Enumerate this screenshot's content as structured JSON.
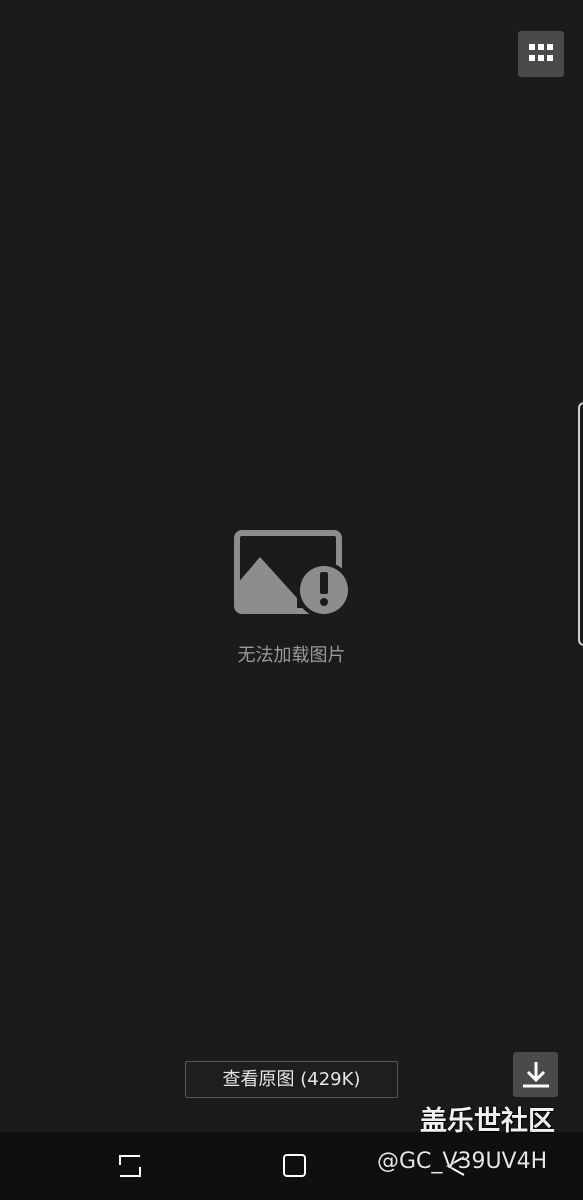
{
  "viewer": {
    "error_message": "无法加载图片",
    "view_original_label": "查看原图 (429K)"
  },
  "watermark": {
    "site": "盖乐世社区",
    "user": "@GC_V39UV4H"
  },
  "icons": {
    "grid": "grid-icon",
    "image_error": "broken-image-icon",
    "download": "download-icon",
    "recents": "recents-icon",
    "home": "home-icon",
    "back": "back-icon"
  },
  "colors": {
    "background": "#1b1b1b",
    "button_fill": "#4a4a4a",
    "error_gray": "#8d8d8d",
    "nav_bar": "#0f0f0f"
  }
}
